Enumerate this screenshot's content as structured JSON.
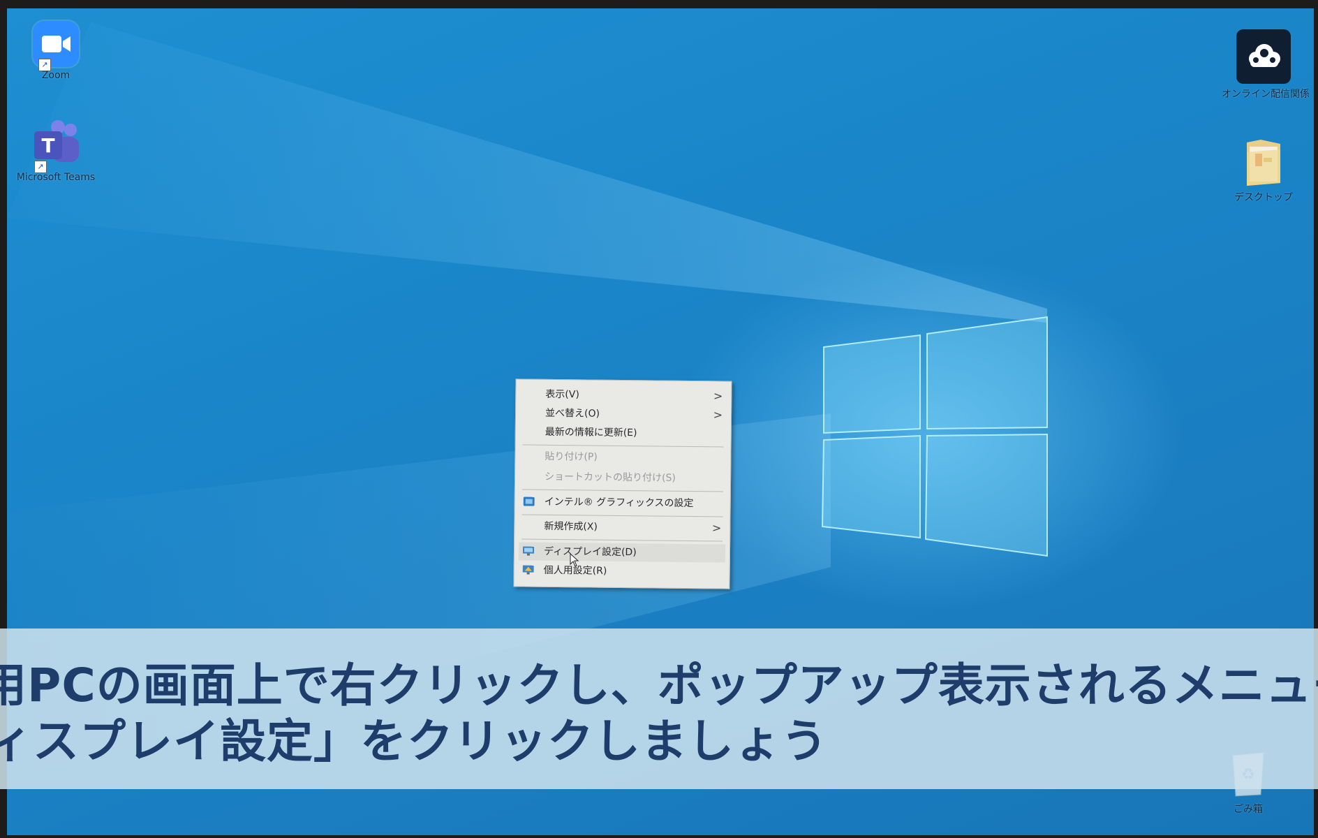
{
  "desktop": {
    "icons_left": [
      {
        "label": "Zoom",
        "icon": "zoom-icon"
      },
      {
        "label": "Microsoft Teams",
        "icon": "teams-icon"
      }
    ],
    "icons_right": [
      {
        "label": "オンライン配信関係",
        "icon": "cloud-icon"
      },
      {
        "label": "デスクトップ",
        "icon": "folder-icon"
      },
      {
        "label": "ごみ箱",
        "icon": "recycle-bin-icon"
      }
    ]
  },
  "context_menu": {
    "items": [
      {
        "label": "表示(V)",
        "has_submenu": true
      },
      {
        "label": "並べ替え(O)",
        "has_submenu": true
      },
      {
        "label": "最新の情報に更新(E)"
      },
      {
        "label": "貼り付け(P)",
        "disabled": true
      },
      {
        "label": "ショートカットの貼り付け(S)",
        "disabled": true
      },
      {
        "label": "インテル® グラフィックスの設定",
        "icon": "intel-graphics-icon"
      },
      {
        "label": "新規作成(X)",
        "has_submenu": true
      },
      {
        "label": "ディスプレイ設定(D)",
        "icon": "display-icon",
        "hovered": true
      },
      {
        "label": "個人用設定(R)",
        "icon": "personalize-icon"
      }
    ]
  },
  "caption": {
    "line1": "用PCの画面上で右クリックし、ポップアップ表示されるメニューか",
    "line2": "ィスプレイ設定」をクリックしましょう"
  },
  "colors": {
    "wallpaper": "#1a86c9",
    "menu_bg": "#e9e9e6",
    "caption_text": "#1f3d6a"
  }
}
